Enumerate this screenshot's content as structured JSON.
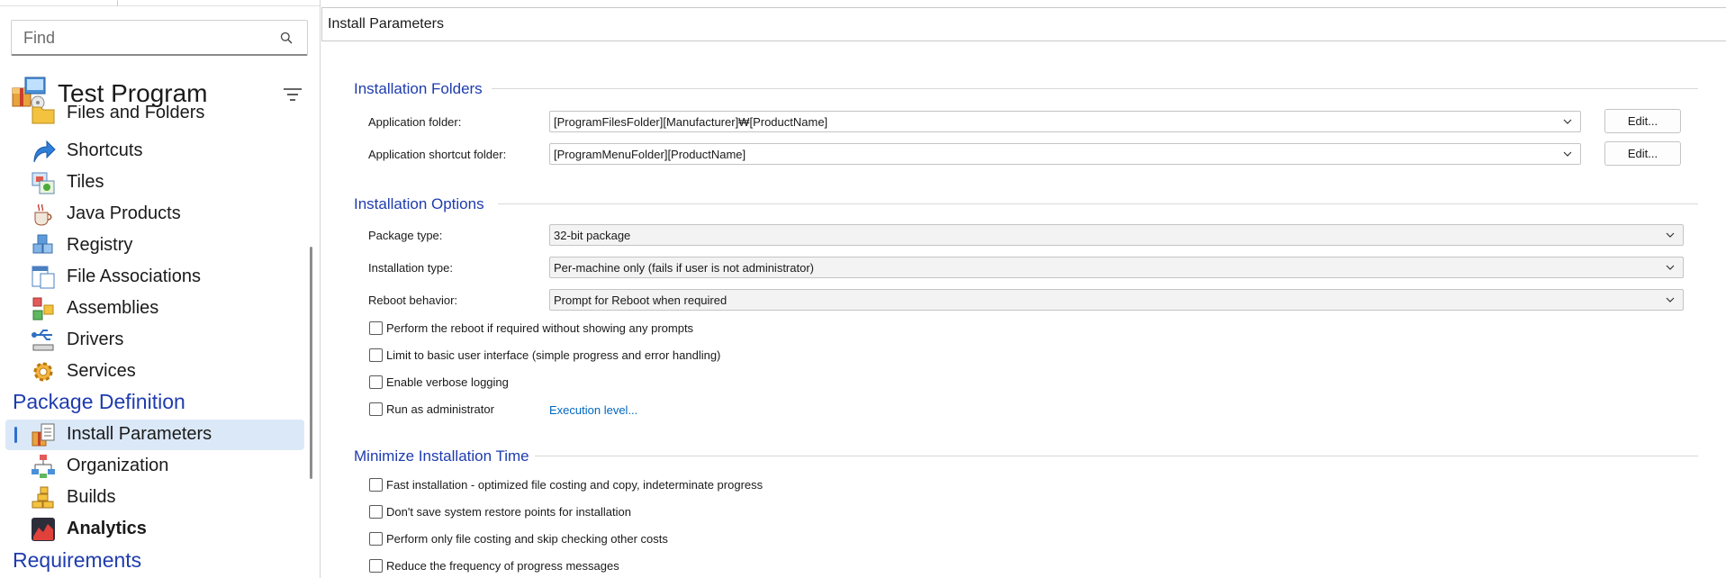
{
  "sidebar": {
    "search": {
      "placeholder": "Find",
      "value": ""
    },
    "project": {
      "title": "Test Program"
    },
    "items": [
      {
        "label": "Files and Folders",
        "icon": "files-folders-icon"
      },
      {
        "label": "Shortcuts",
        "icon": "shortcut-arrow-icon"
      },
      {
        "label": "Tiles",
        "icon": "tiles-icon"
      },
      {
        "label": "Java Products",
        "icon": "java-cup-icon"
      },
      {
        "label": "Registry",
        "icon": "registry-cubes-icon"
      },
      {
        "label": "File Associations",
        "icon": "file-associations-icon"
      },
      {
        "label": "Assemblies",
        "icon": "assemblies-icon"
      },
      {
        "label": "Drivers",
        "icon": "usb-driver-icon"
      },
      {
        "label": "Services",
        "icon": "services-gear-icon"
      }
    ],
    "group_package_definition": "Package Definition",
    "package_items": [
      {
        "label": "Install Parameters",
        "icon": "install-parameters-icon",
        "selected": true
      },
      {
        "label": "Organization",
        "icon": "organization-chart-icon"
      },
      {
        "label": "Builds",
        "icon": "builds-bricks-icon"
      },
      {
        "label": "Analytics",
        "icon": "analytics-chart-icon",
        "bold": true
      }
    ],
    "group_requirements": "Requirements"
  },
  "main": {
    "title": "Install Parameters",
    "installation_folders": {
      "title": "Installation Folders",
      "app_folder_label": "Application folder:",
      "app_folder_value": "[ProgramFilesFolder][Manufacturer]₩[ProductName]",
      "shortcut_folder_label": "Application shortcut folder:",
      "shortcut_folder_value": "[ProgramMenuFolder][ProductName]",
      "edit_label": "Edit..."
    },
    "installation_options": {
      "title": "Installation Options",
      "package_type_label": "Package type:",
      "package_type_value": "32-bit package",
      "installation_type_label": "Installation type:",
      "installation_type_value": "Per-machine only (fails if user is not administrator)",
      "reboot_label": "Reboot behavior:",
      "reboot_value": "Prompt for Reboot when required",
      "checkboxes": [
        {
          "label": "Perform the reboot if required without showing any prompts",
          "checked": false
        },
        {
          "label": "Limit to basic user interface (simple progress and error handling)",
          "checked": false
        },
        {
          "label": "Enable verbose logging",
          "checked": false
        },
        {
          "label": "Run as administrator",
          "checked": false
        }
      ],
      "execution_level_link": "Execution level..."
    },
    "minimize_time": {
      "title": "Minimize Installation Time",
      "checkboxes": [
        {
          "label": "Fast installation - optimized file costing and copy, indeterminate progress",
          "checked": false
        },
        {
          "label": "Don't save system restore points for installation",
          "checked": false
        },
        {
          "label": "Perform only file costing and skip checking other costs",
          "checked": false
        },
        {
          "label": "Reduce the frequency of progress messages",
          "checked": false
        }
      ]
    }
  },
  "colors": {
    "accent_blue": "#1e3cae",
    "link_blue": "#0067c0",
    "selection_bg": "#dbe8f7",
    "selection_bar": "#2e6fd1"
  }
}
